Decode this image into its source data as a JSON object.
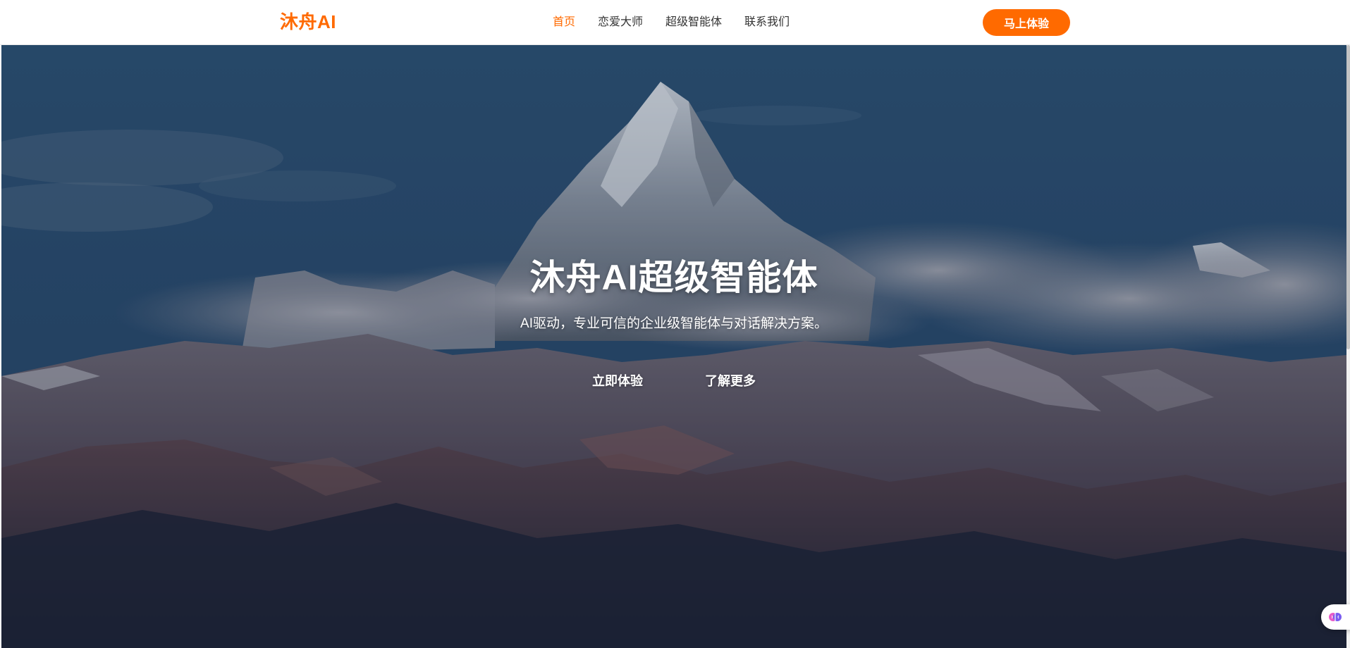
{
  "header": {
    "logo": "沐舟AI",
    "nav": [
      {
        "label": "首页",
        "active": true
      },
      {
        "label": "恋爱大师",
        "active": false
      },
      {
        "label": "超级智能体",
        "active": false
      },
      {
        "label": "联系我们",
        "active": false
      }
    ],
    "cta_label": "马上体验"
  },
  "hero": {
    "title": "沐舟AI超级智能体",
    "subtitle": "AI驱动，专业可信的企业级智能体与对话解决方案。",
    "primary_action": "立即体验",
    "secondary_action": "了解更多",
    "background_description_icon": "mountain-landscape-image"
  },
  "floating_widget": {
    "icon": "brain-icon"
  },
  "colors": {
    "accent": "#ff6a00",
    "nav_text": "#333333",
    "hero_text": "#ffffff"
  }
}
